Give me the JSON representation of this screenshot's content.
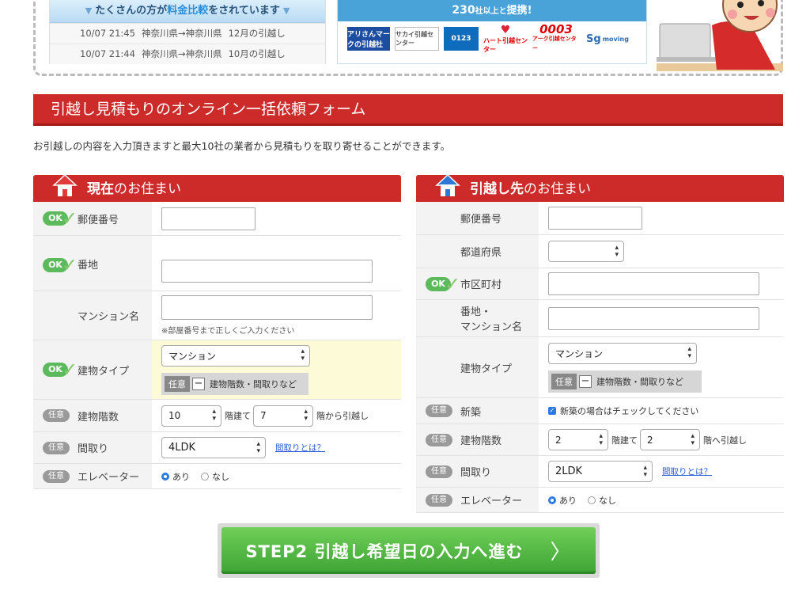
{
  "top": {
    "compare_banner_pre": "たくさんの方が",
    "compare_banner_hl": "料金比較",
    "compare_banner_post": "をされています",
    "history": [
      {
        "time": "10/07 21:45",
        "route": "神奈川県→神奈川県",
        "month": "12月の引越し"
      },
      {
        "time": "10/07 21:44",
        "route": "神奈川県→神奈川県",
        "month": "10月の引越し"
      }
    ],
    "partners_head_big": "230",
    "partners_head_small": "社以上と",
    "partners_head_tail": "提携!",
    "logos": [
      "アリさんマークの引越社",
      "サカイ引越センター",
      "0123",
      "ハート引越センター",
      "0003",
      "Sg"
    ],
    "logo5_sub": "アーク引越センター",
    "logo6_sub": "moving"
  },
  "form": {
    "title": "引越し見積もりのオンライン一括依頼フォーム",
    "lead": "お引越しの内容を入力頂きますと最大10社の業者から見積もりを取り寄せることができます。"
  },
  "badges": {
    "ok": "OK",
    "optional": "任意"
  },
  "current": {
    "head_bold": "現在",
    "head_rest": "のお住まい",
    "postal_label": "郵便番号",
    "address_label": "番地",
    "mansion_label": "マンション名",
    "mansion_note": "※部屋番号まで正しくご入力ください",
    "building_type_label": "建物タイプ",
    "building_type_value": "マンション",
    "optional_toggle_label": "建物階数・間取りなど",
    "floors_label": "建物階数",
    "floors_total": "10",
    "floors_total_suffix": "階建て",
    "floor_from": "7",
    "floor_from_suffix": "階から引越し",
    "layout_label": "間取り",
    "layout_value": "4LDK",
    "layout_link": "間取りとは？",
    "elevator_label": "エレベーター",
    "elevator_yes": "あり",
    "elevator_no": "なし"
  },
  "destination": {
    "head_bold": "引越し先",
    "head_rest": "のお住まい",
    "postal_label": "郵便番号",
    "pref_label": "都道府県",
    "city_label": "市区町村",
    "address_label_1": "番地・",
    "address_label_2": "マンション名",
    "building_type_label": "建物タイプ",
    "building_type_value": "マンション",
    "optional_toggle_label": "建物階数・間取りなど",
    "new_label": "新築",
    "new_check_text": "新築の場合はチェックしてください",
    "floors_label": "建物階数",
    "floors_total": "2",
    "floors_total_suffix": "階建て",
    "floor_to": "2",
    "floor_to_suffix": "階へ引越し",
    "layout_label": "間取り",
    "layout_value": "2LDK",
    "layout_link": "間取りとは？",
    "elevator_label": "エレベーター",
    "elevator_yes": "あり",
    "elevator_no": "なし"
  },
  "cta": {
    "label": "STEP2 引越し希望日の入力へ進む"
  }
}
